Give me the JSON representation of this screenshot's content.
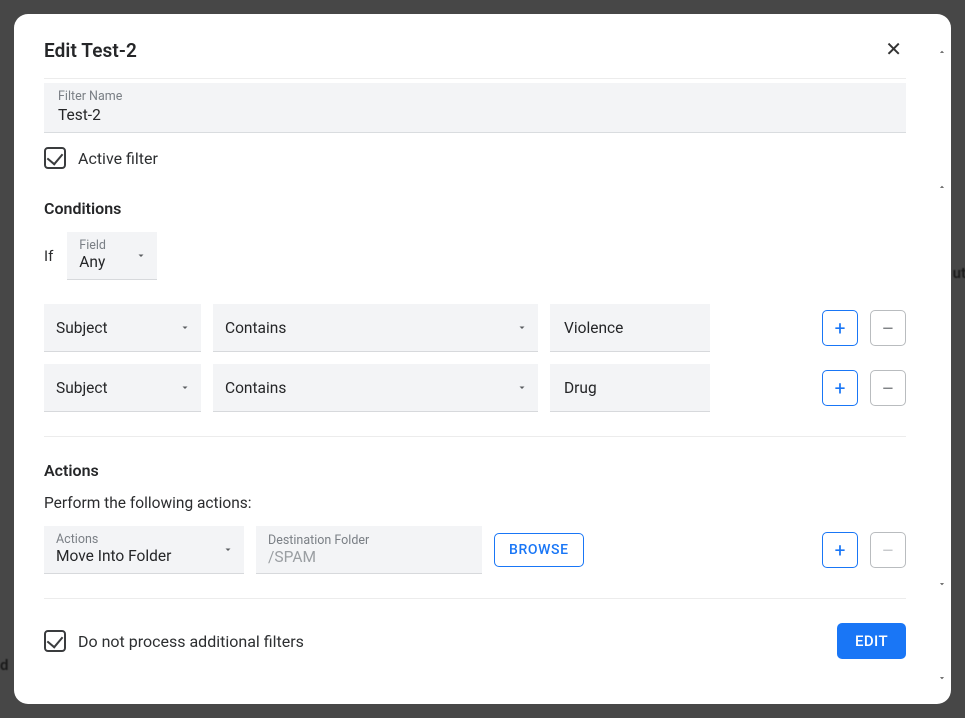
{
  "header": {
    "title": "Edit Test-2"
  },
  "filter": {
    "name_label": "Filter Name",
    "name_value": "Test-2",
    "active_label": "Active filter"
  },
  "conditions": {
    "title": "Conditions",
    "if_label": "If",
    "match_field_label": "Field",
    "match_value": "Any",
    "rows": [
      {
        "field": "Subject",
        "op": "Contains",
        "value": "Violence"
      },
      {
        "field": "Subject",
        "op": "Contains",
        "value": "Drug"
      }
    ]
  },
  "actions": {
    "title": "Actions",
    "perform_label": "Perform the following actions:",
    "rows": [
      {
        "action_label": "Actions",
        "action_value": "Move Into Folder",
        "dest_label": "Destination Folder",
        "dest_value": "/SPAM",
        "browse_label": "BROWSE"
      }
    ]
  },
  "footer": {
    "no_additional_label": "Do not process additional filters",
    "edit_label": "EDIT"
  },
  "icons": {
    "plus": "+",
    "minus": "–"
  }
}
